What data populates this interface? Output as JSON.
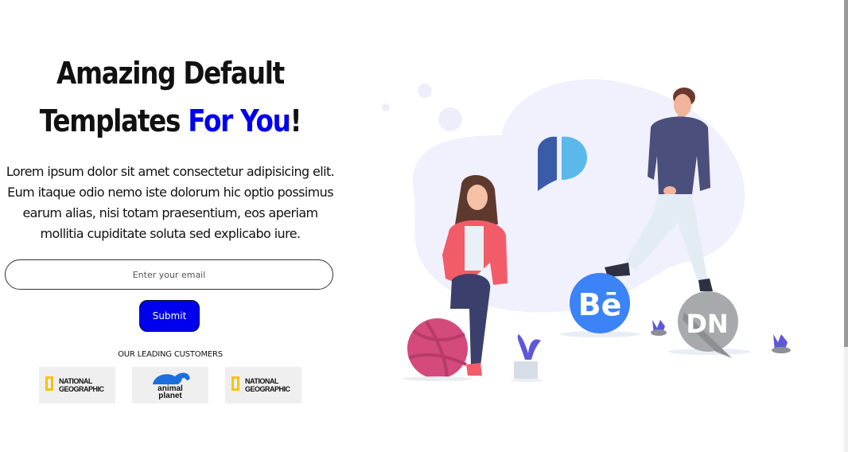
{
  "hero": {
    "title_line1": "Amazing Default",
    "title_line2_prefix": "Templates ",
    "title_accent": "For You",
    "title_suffix": "!",
    "description": "Lorem ipsum dolor sit amet consectetur adipisicing elit. Eum itaque odio nemo iste dolorum hic optio possimus earum alias, nisi totam praesentium, eos aperiam mollitia cupiditate soluta sed explicabo iure.",
    "email_placeholder": "Enter your email",
    "submit_label": "Submit"
  },
  "customers": {
    "label": "OUR LEADING CUSTOMERS",
    "logos": [
      {
        "line1": "NATIONAL",
        "line2": "GEOGRAPHIC"
      },
      {
        "line1": "animal",
        "line2": "planet"
      },
      {
        "line1": "NATIONAL",
        "line2": "GEOGRAPHIC"
      }
    ]
  },
  "illustration": {
    "badges": [
      "Bē",
      "DN"
    ]
  },
  "colors": {
    "accent": "#0000ee",
    "blob": "#f1f0fd",
    "behance": "#3b83f6",
    "dribbble": "#d44a7c",
    "jacket": "#f25c68"
  },
  "icons": [
    "pinterest-p-icon",
    "behance-icon",
    "dribbble-ball-icon",
    "dn-icon"
  ]
}
